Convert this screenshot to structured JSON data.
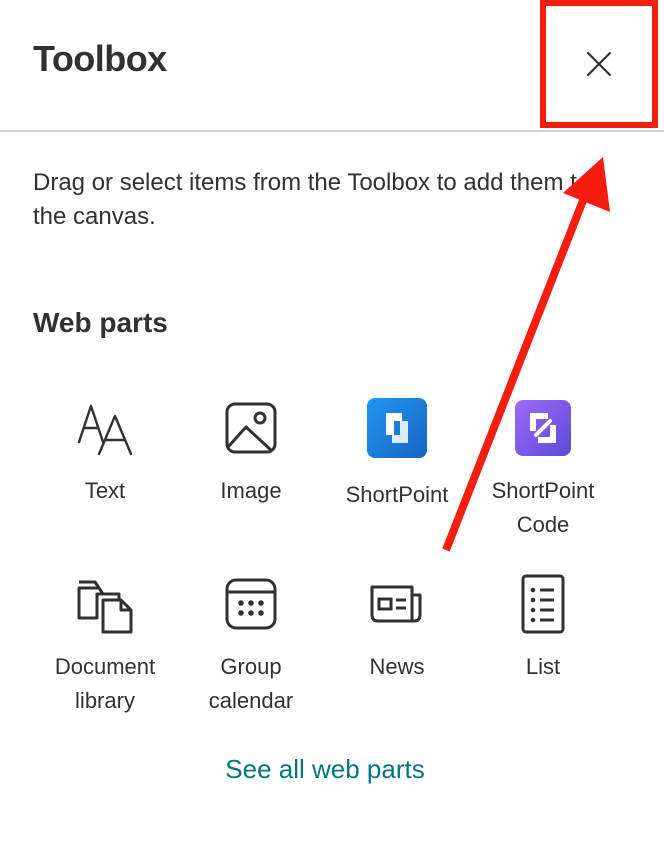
{
  "header": {
    "title": "Toolbox",
    "close_icon": "close-icon"
  },
  "description": "Drag or select items from the Toolbox to add them to the canvas.",
  "section": {
    "title": "Web parts"
  },
  "web_parts": [
    {
      "label": "Text",
      "icon": "text-icon"
    },
    {
      "label": "Image",
      "icon": "image-icon"
    },
    {
      "label": "ShortPoint",
      "icon": "shortpoint-icon"
    },
    {
      "label": "ShortPoint Code",
      "icon": "shortpoint-code-icon"
    },
    {
      "label": "Document library",
      "icon": "document-library-icon"
    },
    {
      "label": "Group calendar",
      "icon": "calendar-icon"
    },
    {
      "label": "News",
      "icon": "news-icon"
    },
    {
      "label": "List",
      "icon": "list-icon"
    }
  ],
  "see_all": "See all web parts",
  "colors": {
    "text": "#323130",
    "link": "#03787c",
    "annotation": "#f41d0e",
    "shortpoint_blue": "#1e88e5",
    "shortpoint_purple": "#7b5cf0"
  }
}
